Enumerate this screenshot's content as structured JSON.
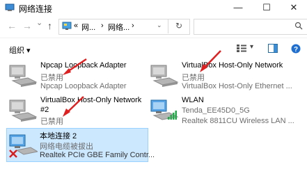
{
  "window": {
    "title": "网络连接",
    "minimize_glyph": "—",
    "maximize_glyph": "☐",
    "close_glyph": "✕"
  },
  "address_bar": {
    "back_glyph": "←",
    "forward_glyph": "→",
    "recent_glyph": "⌄",
    "up_glyph": "↑",
    "prefix": "«",
    "crumbs": [
      "网...",
      "网络..."
    ],
    "separator": "›",
    "refresh_glyph": "↻",
    "search_placeholder": ""
  },
  "toolbar": {
    "organize_label": "组织 ▾",
    "view_dropdown_glyph": "▾"
  },
  "connections": [
    {
      "name": "Npcap Loopback Adapter",
      "status": "已禁用",
      "device": "Npcap Loopback Adapter",
      "state": "disabled"
    },
    {
      "name": "VirtualBox Host-Only Network",
      "status": "已禁用",
      "device": "VirtualBox Host-Only Ethernet ...",
      "state": "disabled"
    },
    {
      "name": "VirtualBox Host-Only Network",
      "name_line2": "#2",
      "status": "已禁用",
      "device": "",
      "state": "disabled"
    },
    {
      "name": "WLAN",
      "status": "Tenda_EE45D0_5G",
      "device": "Realtek 8811CU Wireless LAN ...",
      "state": "wifi"
    },
    {
      "name": "本地连接 2",
      "status": "网络电缆被拔出",
      "device": "Realtek PCIe GBE Family Contr...",
      "state": "unplugged"
    }
  ],
  "colors": {
    "accent": "#cce8ff",
    "annotation_arrow": "#e02020"
  }
}
